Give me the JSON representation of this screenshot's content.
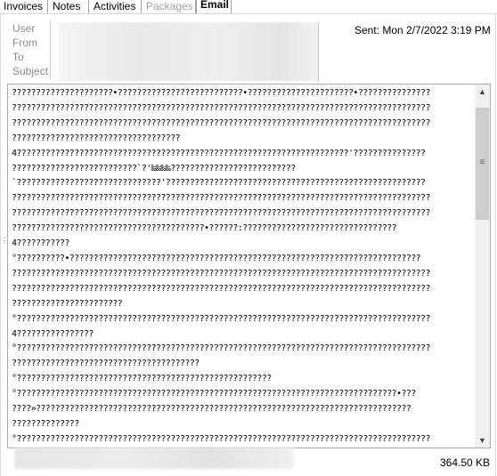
{
  "tabs": [
    {
      "label": "Invoices"
    },
    {
      "label": "Notes"
    },
    {
      "label": "Activities"
    },
    {
      "label": "Packages"
    },
    {
      "label": "Email"
    }
  ],
  "header": {
    "labels": [
      "User",
      "From",
      "To",
      "Subject"
    ],
    "sent": "Sent: Mon 2/7/2022 3:19 PM"
  },
  "body_lines": [
    "?????????????????????•??????????????????????????•??????????????????????•???????????????",
    "???????????????????????????????????????????????????????????????????????????????????????",
    "???????????????????????????????????????????????????????????????????????????????????????",
    "???????????????????????????????????",
    "4?????????????????????????????????????????????????????????????????????'???????????????",
    "??????????????????????????`?'‰‰‰‰??????????????????????????",
    "`??????????????????????????????'??????????????????????????????????????????????????????",
    "???????????????????????????????????????????????????????????????????????????????????????",
    "???????????????????????????????????????????????????????????????????????????????????????",
    "????????????????????????????????????????•??????:????????????????????????????????",
    "4???????????",
    "°??????????•?????????????????????????????????????????????????????????????????????????",
    "???????????????????????????????????????????????????????????????????????????????????????",
    "???????????????????????????????????????????????????????????????????????????????????????",
    "???????????????????????",
    "°??????????????????????????????????????????????????????????????????????????????????????",
    "4????????????????",
    "°??????????????????????????????????????????????????????????????????????????????????????",
    "???????????????????????????????????????",
    "°?????????????????????????????????????????????????????",
    "°???????????????????????????????????????????????????????????????????????????????•???",
    "????»??????????????????????????????????????????????????????????????????????????????",
    "??????????????",
    "°??????????????????????????????????????????????????????????????????????????????????????"
  ],
  "footer": {
    "size": "364.50 KB"
  },
  "icons": {
    "scroll_up": "▲",
    "scroll_down": "▼",
    "grip": "≡",
    "splitter": "⋮"
  }
}
